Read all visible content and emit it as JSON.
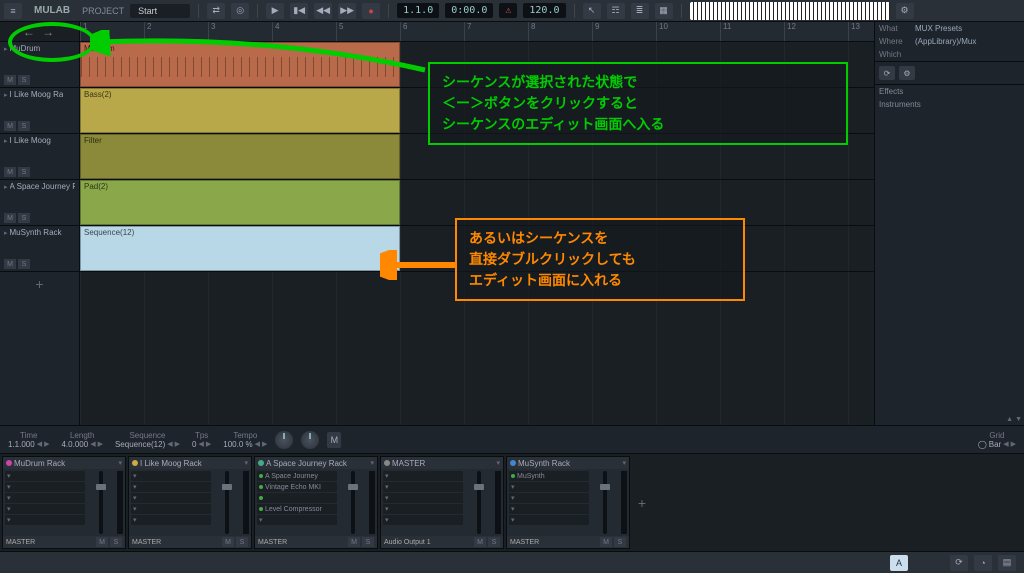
{
  "topbar": {
    "brand": "MULAB",
    "project_label": "PROJECT",
    "project_name": "Start",
    "position": "1.1.0",
    "time": "0:00.0",
    "warn": "⚠",
    "tempo": "120.0"
  },
  "tracks": [
    {
      "name": "MuDrum",
      "ms_m": "M",
      "ms_s": "S"
    },
    {
      "name": "I Like Moog Ra",
      "ms_m": "M",
      "ms_s": "S"
    },
    {
      "name": "I Like Moog",
      "ms_m": "M",
      "ms_s": "S"
    },
    {
      "name": "A Space Journey R",
      "ms_m": "M",
      "ms_s": "S"
    },
    {
      "name": "MuSynth Rack",
      "ms_m": "M",
      "ms_s": "S"
    }
  ],
  "add_label": "+",
  "ruler_bars": [
    "1",
    "2",
    "3",
    "4",
    "5",
    "6",
    "7",
    "8",
    "9",
    "10",
    "11",
    "12",
    "13"
  ],
  "clips": [
    {
      "lane": 0,
      "name": "MuDrum",
      "cls": "drums"
    },
    {
      "lane": 1,
      "name": "Bass(2)",
      "cls": "bass"
    },
    {
      "lane": 2,
      "name": "Filter",
      "cls": "filter"
    },
    {
      "lane": 3,
      "name": "Pad(2)",
      "cls": "pad"
    },
    {
      "lane": 4,
      "name": "Sequence(12)",
      "cls": "seq"
    }
  ],
  "rightpanel": {
    "rows": [
      {
        "k": "What",
        "v": "MUX Presets"
      },
      {
        "k": "Where",
        "v": "(AppLibrary)/Mux"
      },
      {
        "k": "Which",
        "v": ""
      }
    ],
    "list": [
      "Effects",
      "Instruments"
    ]
  },
  "bottomstrip": {
    "params": [
      {
        "k": "Time",
        "v": "1.1.000"
      },
      {
        "k": "Length",
        "v": "4.0.000"
      },
      {
        "k": "Sequence",
        "v": "Sequence(12)"
      },
      {
        "k": "Tps",
        "v": "0"
      },
      {
        "k": "Tempo",
        "v": "100.0 %"
      }
    ],
    "m_label": "M",
    "grid_k": "Grid",
    "grid_v": "Bar"
  },
  "mixer": [
    {
      "name": "MuDrum Rack",
      "led": "#c4a",
      "slots": [],
      "foot": "MASTER"
    },
    {
      "name": "I Like Moog Rack",
      "led": "#ca4",
      "slots": [],
      "foot": "MASTER"
    },
    {
      "name": "A Space Journey Rack",
      "led": "#4a8",
      "slots": [
        "A Space Journey",
        "Vintage Echo MKI",
        "",
        "Level Compressor"
      ],
      "foot": "MASTER"
    },
    {
      "name": "MASTER",
      "led": "#888",
      "slots": [],
      "foot": "Audio Output 1"
    },
    {
      "name": "MuSynth Rack",
      "led": "#48c",
      "slots": [
        "MuSynth"
      ],
      "foot": "MASTER"
    }
  ],
  "ms_label_m": "M",
  "ms_label_s": "S",
  "bottombar": {
    "a_label": "A"
  },
  "annotations": {
    "green": "シーケンスが選択された状態で\n＜ー＞ボタンをクリックすると\nシーケンスのエディット画面へ入る",
    "orange": "あるいはシーケンスを\n直接ダブルクリックしても\nエディット画面に入れる"
  }
}
